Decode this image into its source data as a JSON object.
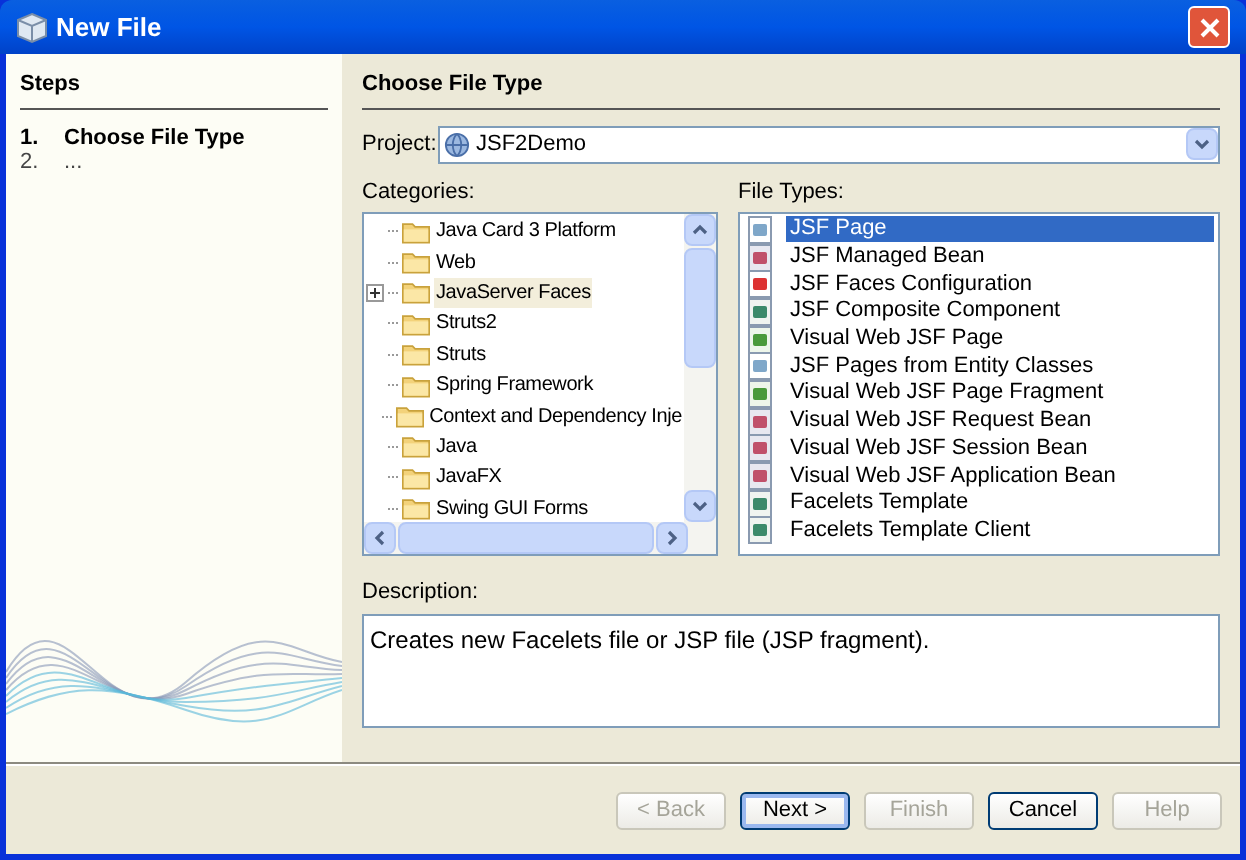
{
  "window": {
    "title": "New File"
  },
  "steps": {
    "title": "Steps",
    "items": [
      {
        "number": "1.",
        "label": "Choose File Type",
        "current": true
      },
      {
        "number": "2.",
        "label": "...",
        "current": false
      }
    ]
  },
  "panel_title": "Choose File Type",
  "project": {
    "label": "Project:",
    "value": "JSF2Demo"
  },
  "categories": {
    "label": "Categories:",
    "items": [
      {
        "label": "Java Card 3 Platform",
        "expandable": false,
        "highlighted": false
      },
      {
        "label": "Web",
        "expandable": false,
        "highlighted": false
      },
      {
        "label": "JavaServer Faces",
        "expandable": true,
        "highlighted": true
      },
      {
        "label": "Struts2",
        "expandable": false,
        "highlighted": false
      },
      {
        "label": "Struts",
        "expandable": false,
        "highlighted": false
      },
      {
        "label": "Spring Framework",
        "expandable": false,
        "highlighted": false
      },
      {
        "label": "Context and Dependency Inje",
        "expandable": false,
        "highlighted": false
      },
      {
        "label": "Java",
        "expandable": false,
        "highlighted": false
      },
      {
        "label": "JavaFX",
        "expandable": false,
        "highlighted": false
      },
      {
        "label": "Swing GUI Forms",
        "expandable": false,
        "highlighted": false
      }
    ]
  },
  "file_types": {
    "label": "File Types:",
    "items": [
      {
        "label": "JSF Page",
        "selected": true,
        "kind": "page"
      },
      {
        "label": "JSF Managed Bean",
        "selected": false,
        "kind": "bean"
      },
      {
        "label": "JSF Faces Configuration",
        "selected": false,
        "kind": "config"
      },
      {
        "label": "JSF Composite Component",
        "selected": false,
        "kind": "component"
      },
      {
        "label": "Visual Web JSF Page",
        "selected": false,
        "kind": "visual"
      },
      {
        "label": "JSF Pages from Entity Classes",
        "selected": false,
        "kind": "page"
      },
      {
        "label": "Visual Web JSF Page Fragment",
        "selected": false,
        "kind": "visual"
      },
      {
        "label": "Visual Web JSF Request Bean",
        "selected": false,
        "kind": "bean"
      },
      {
        "label": "Visual Web JSF Session Bean",
        "selected": false,
        "kind": "bean"
      },
      {
        "label": "Visual Web JSF Application Bean",
        "selected": false,
        "kind": "bean"
      },
      {
        "label": "Facelets Template",
        "selected": false,
        "kind": "component"
      },
      {
        "label": "Facelets Template Client",
        "selected": false,
        "kind": "component"
      }
    ]
  },
  "description": {
    "label": "Description:",
    "text": "Creates new Facelets file or JSP file (JSP fragment)."
  },
  "buttons": [
    {
      "label": "< Back",
      "disabled": true,
      "default": false
    },
    {
      "label": "Next >",
      "disabled": false,
      "default": true
    },
    {
      "label": "Finish",
      "disabled": true,
      "default": false
    },
    {
      "label": "Cancel",
      "disabled": false,
      "default": false
    },
    {
      "label": "Help",
      "disabled": true,
      "default": false
    }
  ]
}
